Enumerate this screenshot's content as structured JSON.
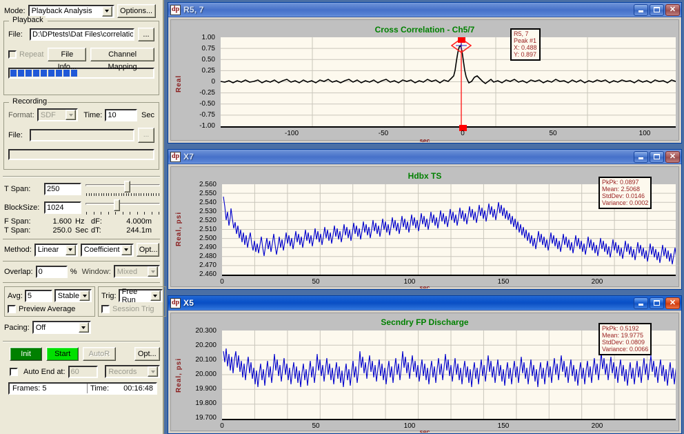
{
  "control_panel": {
    "mode": {
      "label": "Mode:",
      "value": "Playback Analysis",
      "options_button": "Options..."
    },
    "playback": {
      "group_title": "Playback",
      "file_label": "File:",
      "file_value": "D:\\DPtests\\Dat Files\\correlation",
      "browse_button": "...",
      "repeat_label": "Repeat",
      "file_info_button": "File Info...",
      "channel_mapping_button": "Channel Mapping",
      "progress_blocks": 9
    },
    "recording": {
      "group_title": "Recording",
      "format_label": "Format:",
      "format_value": "SDF",
      "time_label": "Time:",
      "time_value": "10",
      "sec_label": "Sec",
      "file_label": "File:",
      "file_value": ""
    },
    "spans": {
      "tspan_label": "T Span:",
      "tspan_value": "250",
      "blocksize_label": "BlockSize:",
      "blocksize_value": "1024",
      "fspan_label": "F Span:",
      "fspan_value": "1.600",
      "fspan_unit": "Hz",
      "df_label": "dF:",
      "df_value": "4.000m",
      "tspan2_label": "T Span:",
      "tspan2_value": "250.0",
      "tspan2_unit": "Sec",
      "dt_label": "dT:",
      "dt_value": "244.1m"
    },
    "method": {
      "label": "Method:",
      "value": "Linear",
      "value2": "Coefficient",
      "opt_button": "Opt..."
    },
    "overlap": {
      "label": "Overlap:",
      "value": "0",
      "percent": "%",
      "window_label": "Window:",
      "window_value": "Mixed"
    },
    "averaging": {
      "avg_label": "Avg:",
      "avg_value": "5",
      "avg_mode": "Stable",
      "preview_average_label": "Preview Average",
      "trig_label": "Trig:",
      "trig_value": "Free Run",
      "session_trig_label": "Session Trig"
    },
    "pacing": {
      "label": "Pacing:",
      "value": "Off"
    },
    "run": {
      "init_button": "Init",
      "start_button": "Start",
      "autor_button": "AutoR",
      "opt_button": "Opt...",
      "auto_end_label": "Auto End at:",
      "auto_end_value": "60",
      "auto_end_units": "Records",
      "frames_text": "Frames: 5",
      "time_label": "Time:",
      "time_value": "00:16:48"
    },
    "colors": {
      "panel_bg": "#ece9d8",
      "init_green": "#008000",
      "start_green": "#00e000",
      "progress_blue": "#2059d8"
    }
  },
  "windows": [
    {
      "title": "R5, 7",
      "icon": "dp-app-icon",
      "active": false,
      "buttons": {
        "minimize": "minimize-icon",
        "maximize": "maximize-icon",
        "close": "close-icon"
      }
    },
    {
      "title": "X7",
      "icon": "dp-app-icon",
      "active": false,
      "buttons": {
        "minimize": "minimize-icon",
        "maximize": "maximize-icon",
        "close": "close-icon"
      }
    },
    {
      "title": "X5",
      "icon": "dp-app-icon",
      "active": true,
      "buttons": {
        "minimize": "minimize-icon",
        "maximize": "maximize-icon",
        "close": "close-icon"
      }
    }
  ],
  "chart_data": [
    {
      "type": "line",
      "window": "R5, 7",
      "title": "Cross Correlation - Ch5/7",
      "title_color": "#008000",
      "xlabel": "sec",
      "ylabel": "Real",
      "xticks": [
        "-100",
        "-50",
        "0",
        "50",
        "100"
      ],
      "xtick_values": [
        -100,
        -50,
        0,
        50,
        100
      ],
      "yticks": [
        "1.00",
        "0.75",
        "0.50",
        "0.25",
        "0",
        "-0.25",
        "-0.50",
        "-0.75",
        "-1.00"
      ],
      "ytick_values": [
        1.0,
        0.75,
        0.5,
        0.25,
        0,
        -0.25,
        -0.5,
        -0.75,
        -1.0
      ],
      "xlim": [
        -125,
        125
      ],
      "ylim": [
        -1.0,
        1.0
      ],
      "grid": true,
      "trace_color": "#000000",
      "cursor": {
        "x": 0.488,
        "color": "#ff0000",
        "marker": "diamond"
      },
      "annotation": {
        "line1": "R5, 7",
        "line2": "Peak #1",
        "line3": "X: 0.488",
        "line4": "Y: 0.897"
      },
      "peak": {
        "x": 0.488,
        "y": 0.897
      }
    },
    {
      "type": "line",
      "window": "X7",
      "title": "Hdbx TS",
      "title_color": "#008000",
      "xlabel": "sec",
      "ylabel": "Real, psi",
      "xticks": [
        "0",
        "50",
        "100",
        "150",
        "200"
      ],
      "xtick_values": [
        0,
        50,
        100,
        150,
        200
      ],
      "yticks": [
        "2.560",
        "2.550",
        "2.540",
        "2.530",
        "2.520",
        "2.510",
        "2.500",
        "2.490",
        "2.480",
        "2.470",
        "2.460"
      ],
      "ytick_values": [
        2.56,
        2.55,
        2.54,
        2.53,
        2.52,
        2.51,
        2.5,
        2.49,
        2.48,
        2.47,
        2.46
      ],
      "xlim": [
        0,
        244
      ],
      "ylim": [
        2.46,
        2.56
      ],
      "grid": true,
      "trace_color": "#0000cc",
      "annotation": {
        "line1": "PkPk: 0.0897",
        "line2": "Mean: 2.5068",
        "line3": "StdDev: 0.0146",
        "line4": "Variance: 0.0002"
      },
      "stats": {
        "pkpk": 0.0897,
        "mean": 2.5068,
        "stddev": 0.0146,
        "variance": 0.0002
      }
    },
    {
      "type": "line",
      "window": "X5",
      "title": "Secndry FP Discharge",
      "title_color": "#008000",
      "xlabel": "sec",
      "ylabel": "Real, psi",
      "xticks": [
        "0",
        "50",
        "100",
        "150",
        "200"
      ],
      "xtick_values": [
        0,
        50,
        100,
        150,
        200
      ],
      "yticks": [
        "20.300",
        "20.200",
        "20.100",
        "20.000",
        "19.900",
        "19.800",
        "19.700"
      ],
      "ytick_values": [
        20.3,
        20.2,
        20.1,
        20.0,
        19.9,
        19.8,
        19.7
      ],
      "xlim": [
        0,
        244
      ],
      "ylim": [
        19.7,
        20.3
      ],
      "grid": true,
      "trace_color": "#0000cc",
      "annotation": {
        "line1": "PkPk: 0.5192",
        "line2": "Mean: 19.9775",
        "line3": "StdDev: 0.0809",
        "line4": "Variance: 0.0066"
      },
      "stats": {
        "pkpk": 0.5192,
        "mean": 19.9775,
        "stddev": 0.0809,
        "variance": 0.0066
      }
    }
  ]
}
